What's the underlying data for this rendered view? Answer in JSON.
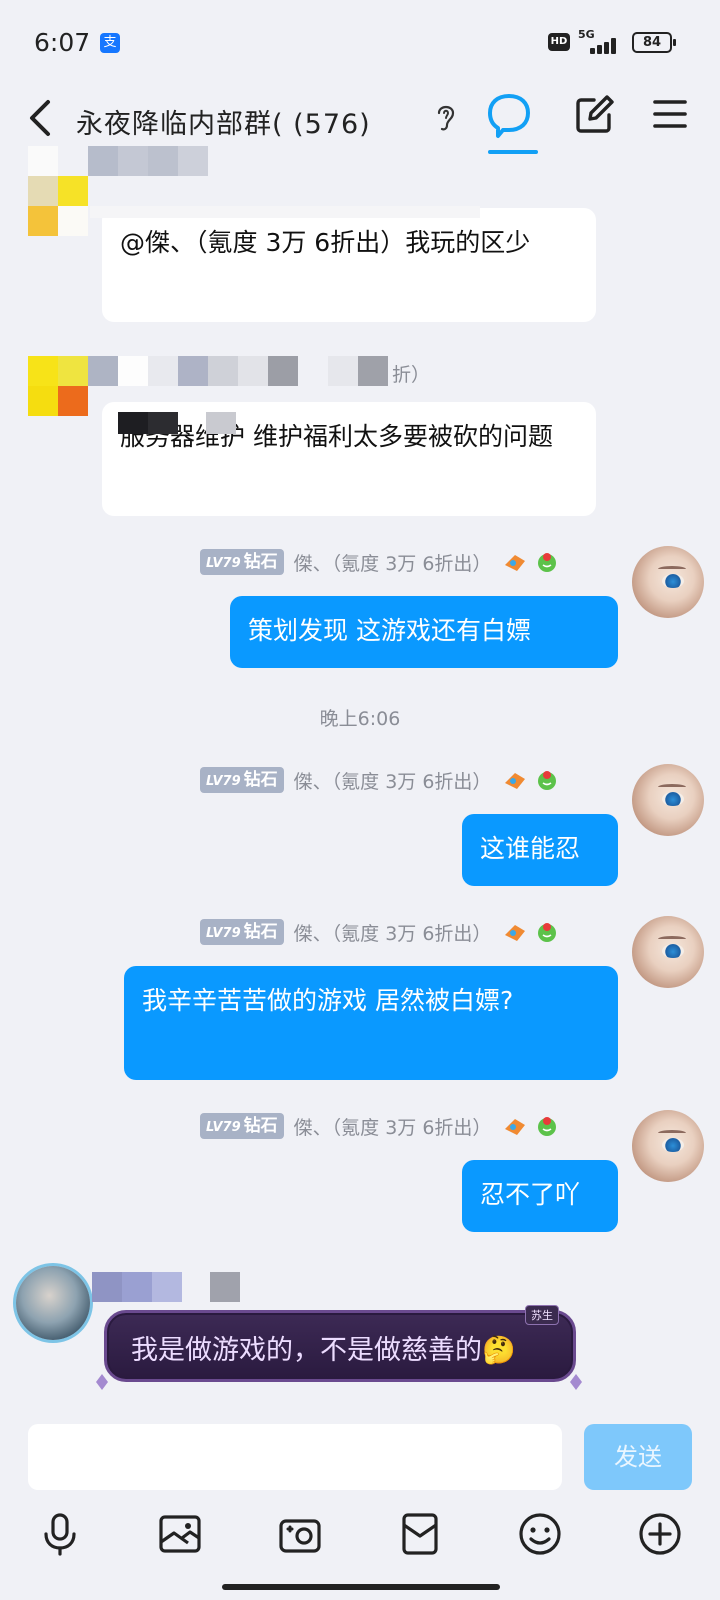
{
  "status_bar": {
    "time": "6:07",
    "alipay_icon": "支",
    "hd": "HD",
    "network": "5G",
    "battery": "84"
  },
  "header": {
    "title": "永夜降临内部群(      (576)",
    "icons": [
      "back-arrow-icon",
      "ear-icon",
      "chat-bubble-icon",
      "edit-icon",
      "menu-icon"
    ]
  },
  "messages": [
    {
      "side": "in",
      "text": "@傑、（氪度 3万   6折出）我玩的区少"
    },
    {
      "side": "in",
      "sender_suffix": "折）",
      "text": "服务器维护 维护福利太多要被砍的问题"
    },
    {
      "side": "out",
      "level": "LV79",
      "rank": "钻石",
      "sender": "傑、（氪度 3万   6折出）",
      "text": "策划发现  这游戏还有白嫖"
    },
    {
      "side": "out",
      "level": "LV79",
      "rank": "钻石",
      "sender": "傑、（氪度 3万   6折出）",
      "text": "这谁能忍"
    },
    {
      "side": "out",
      "level": "LV79",
      "rank": "钻石",
      "sender": "傑、（氪度 3万   6折出）",
      "text": "我辛辛苦苦做的游戏 居然被白嫖?"
    },
    {
      "side": "out",
      "level": "LV79",
      "rank": "钻石",
      "sender": "傑、（氪度 3万   6折出）",
      "text": "忍不了吖"
    },
    {
      "side": "in",
      "tag": "苏生",
      "text": "我是做游戏的，不是做慈善的🤔"
    }
  ],
  "timestamp": "晚上6:06",
  "input": {
    "placeholder": "",
    "send_label": "发送"
  },
  "toolbar": [
    "microphone-icon",
    "image-icon",
    "camera-icon",
    "red-packet-icon",
    "emoji-icon",
    "plus-icon"
  ],
  "colors": {
    "accent": "#0a99ff",
    "send_disabled": "#7ec8fb",
    "background": "#f0f1f6"
  }
}
